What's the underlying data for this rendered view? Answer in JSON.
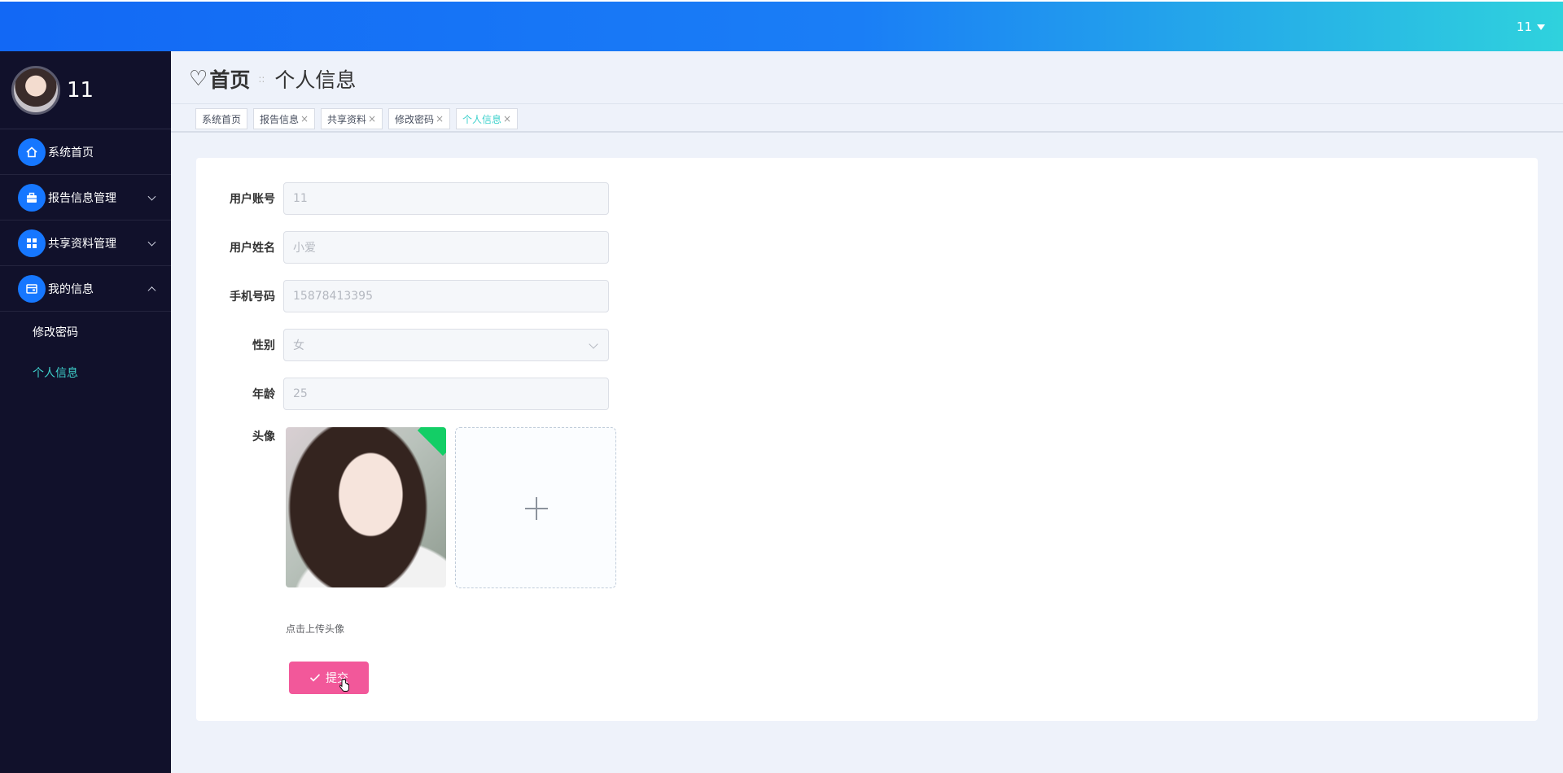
{
  "header": {
    "user_name": "11"
  },
  "sidebar": {
    "profile_name": "11",
    "items": [
      {
        "label": "系统首页",
        "icon": "home-icon"
      },
      {
        "label": "报告信息管理",
        "icon": "briefcase-icon"
      },
      {
        "label": "共享资料管理",
        "icon": "grid-icon"
      },
      {
        "label": "我的信息",
        "icon": "wallet-icon"
      }
    ],
    "submenu": [
      {
        "label": "修改密码"
      },
      {
        "label": "个人信息"
      }
    ]
  },
  "breadcrumb": {
    "home": "首页",
    "current": "个人信息",
    "separator": "::"
  },
  "tabs": [
    {
      "label": "系统首页"
    },
    {
      "label": "报告信息"
    },
    {
      "label": "共享资料"
    },
    {
      "label": "修改密码"
    },
    {
      "label": "个人信息"
    }
  ],
  "form": {
    "account_label": "用户账号",
    "account_value": "11",
    "name_label": "用户姓名",
    "name_value": "小爱",
    "phone_label": "手机号码",
    "phone_value": "15878413395",
    "gender_label": "性别",
    "gender_value": "女",
    "age_label": "年龄",
    "age_value": "25",
    "avatar_label": "头像",
    "upload_tip": "点击上传头像",
    "submit_label": "提交"
  },
  "colors": {
    "accent": "#1677ff",
    "active_text": "#3ed1cc",
    "submit": "#f2589a",
    "sidebar_bg": "#11112b"
  }
}
